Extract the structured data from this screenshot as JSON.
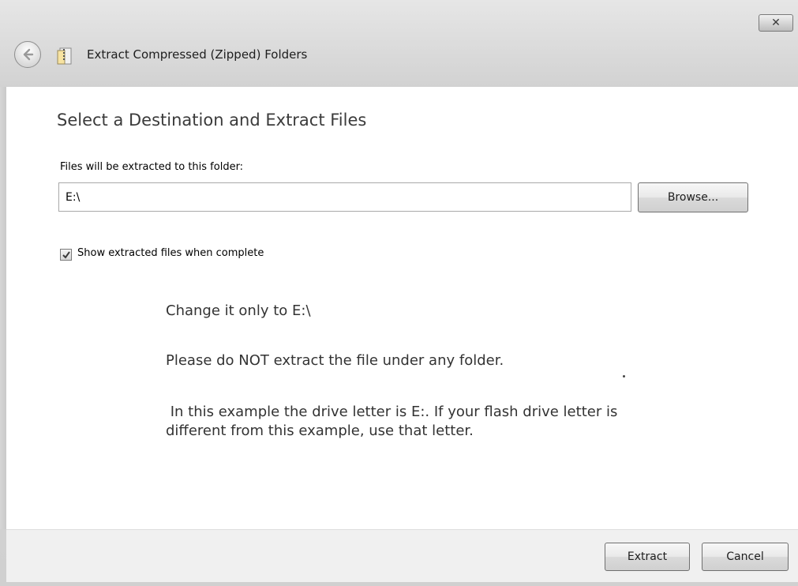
{
  "window": {
    "title": "Extract Compressed (Zipped) Folders",
    "close_glyph": "✕",
    "icons": {
      "back": "back-arrow-icon",
      "title": "zipped-folder-icon",
      "close": "close-icon"
    }
  },
  "main": {
    "heading": "Select a Destination and Extract Files",
    "path_label": "Files will be extracted to this folder:",
    "path_value": "E:\\",
    "browse_label": "Browse...",
    "show_files_label": "Show extracted files when complete",
    "show_files_checked": true,
    "notes": {
      "line1": "Change it only to E:\\",
      "line2": "Please do NOT extract the file under any folder.",
      "line3": " In this example the drive letter is E:. If your flash drive letter is different from this example, use that letter."
    }
  },
  "footer": {
    "extract_label": "Extract",
    "cancel_label": "Cancel"
  }
}
